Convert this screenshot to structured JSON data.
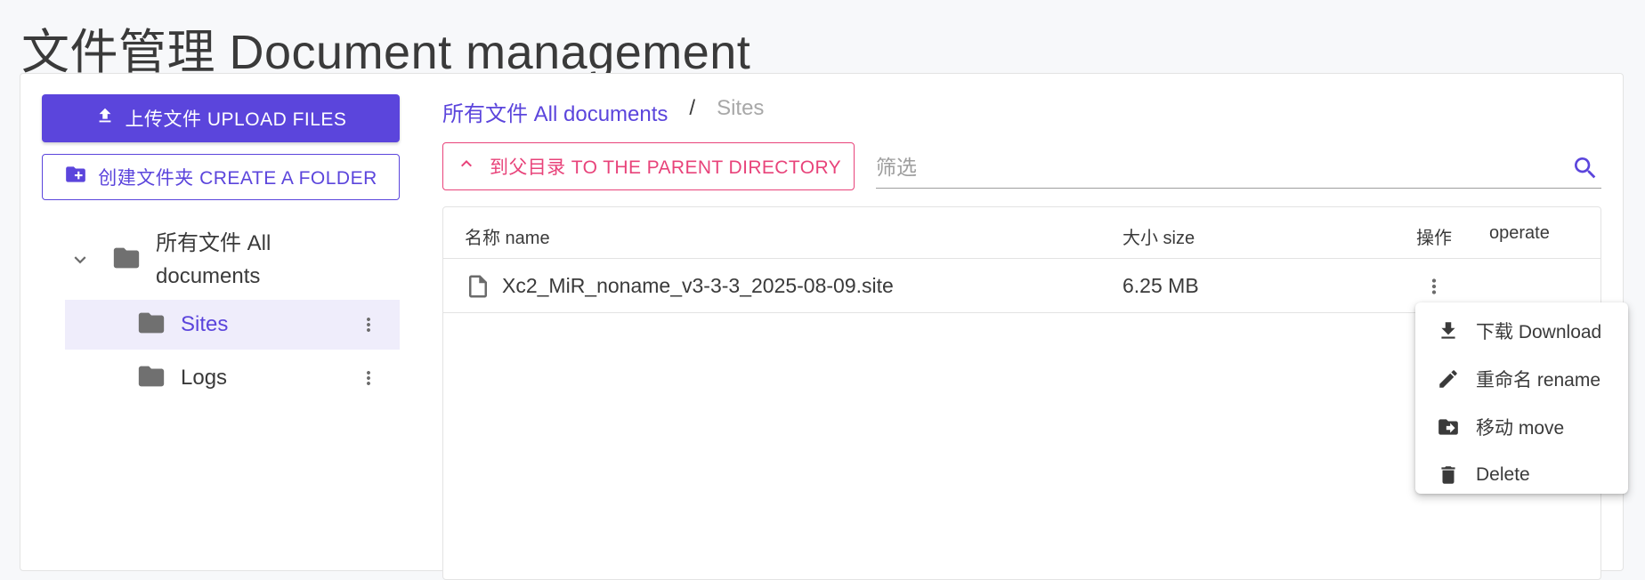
{
  "page": {
    "title": "文件管理  Document management"
  },
  "sidebar": {
    "upload_label": "上传文件  UPLOAD FILES",
    "create_folder_label": "创建文件夹  CREATE A FOLDER",
    "tree": {
      "root_label": "所有文件  All documents",
      "items": [
        {
          "label": "Sites",
          "active": true
        },
        {
          "label": "Logs",
          "active": false
        }
      ]
    }
  },
  "breadcrumb": {
    "root": "所有文件   All documents",
    "separator": "/",
    "current": "Sites"
  },
  "toolbar": {
    "parent_dir_label": "到父目录  TO THE PARENT DIRECTORY",
    "filter_placeholder": "筛选"
  },
  "table": {
    "columns": {
      "name": "名称  name",
      "size": "大小  size",
      "operate_cn": "操作",
      "operate_en": "operate"
    },
    "rows": [
      {
        "name": "Xc2_MiR_noname_v3-3-3_2025-08-09.site",
        "size": "6.25 MB"
      }
    ]
  },
  "context_menu": {
    "items": [
      {
        "label": "下载  Download",
        "icon": "download-icon"
      },
      {
        "label": "重命名  rename",
        "icon": "pencil-icon"
      },
      {
        "label": "移动  move",
        "icon": "folder-move-icon"
      },
      {
        "label": "Delete",
        "icon": "trash-icon"
      }
    ]
  },
  "colors": {
    "primary": "#5b45dc",
    "accent": "#e8437a",
    "active_bg": "#efedfb"
  }
}
